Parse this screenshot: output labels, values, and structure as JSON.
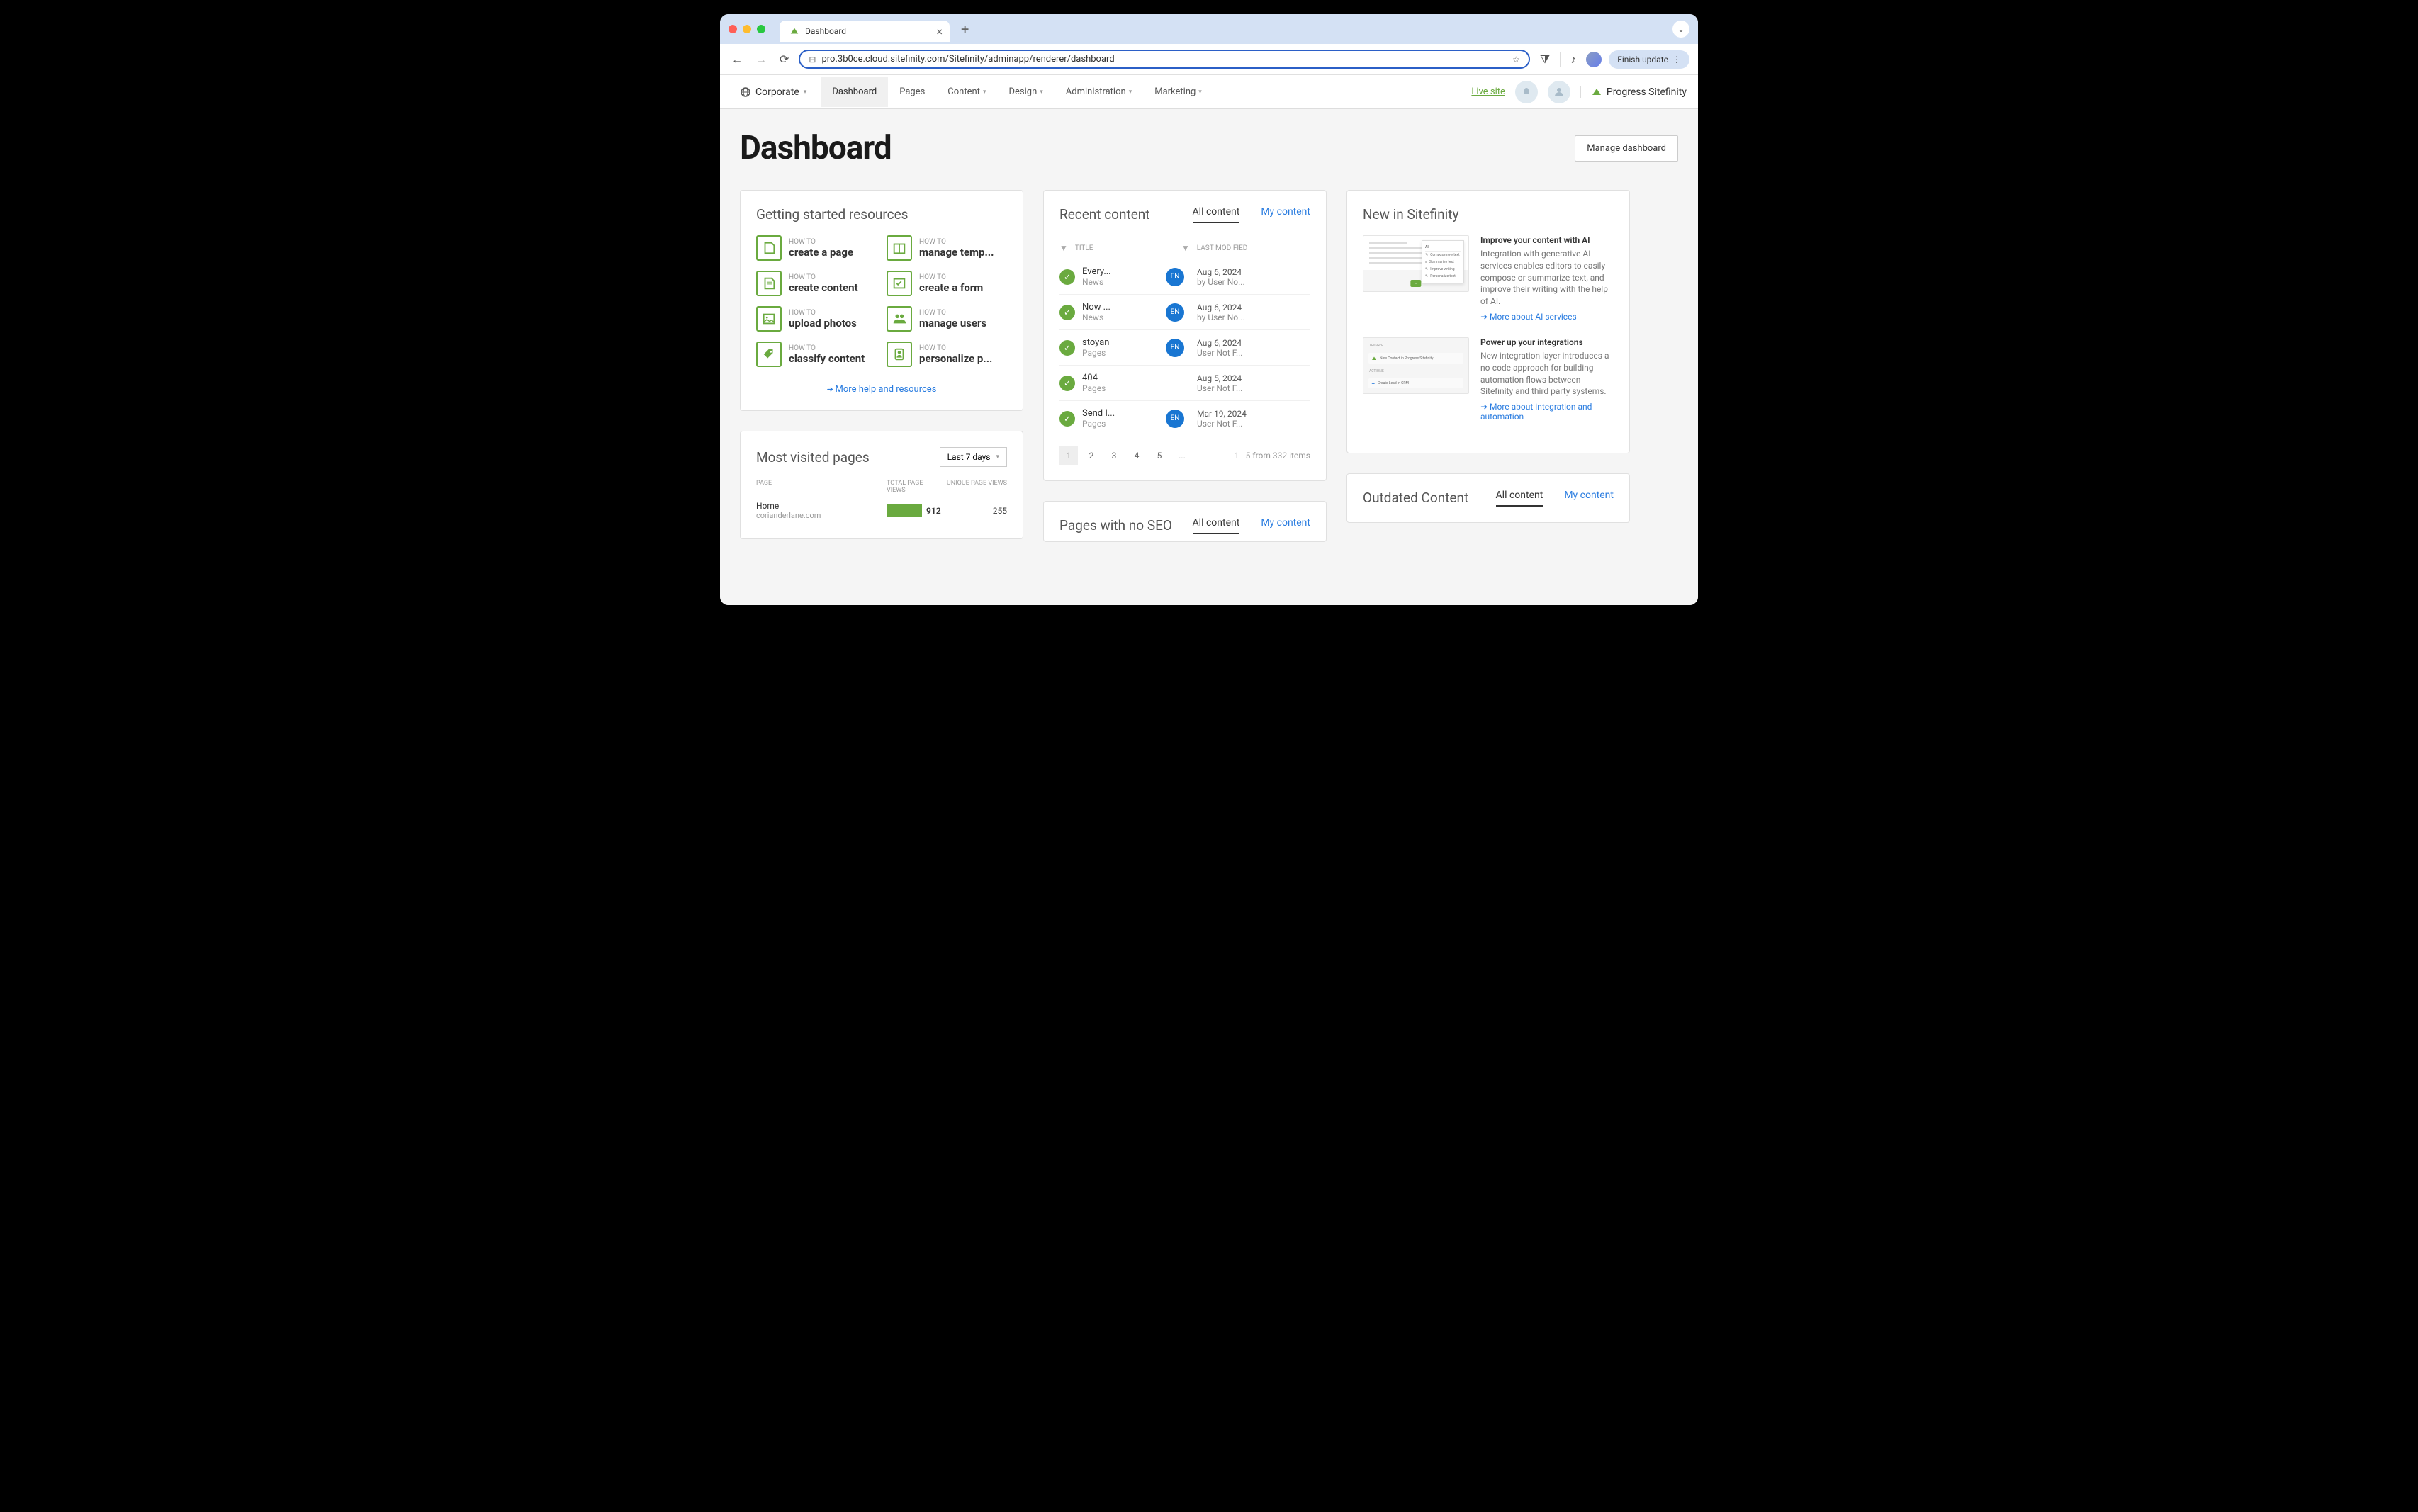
{
  "browser": {
    "tab_title": "Dashboard",
    "url": "pro.3b0ce.cloud.sitefinity.com/Sitefinity/adminapp/renderer/dashboard",
    "finish_update": "Finish update"
  },
  "header": {
    "site": "Corporate",
    "nav": [
      "Dashboard",
      "Pages",
      "Content",
      "Design",
      "Administration",
      "Marketing"
    ],
    "live_site": "Live site",
    "brand": "Progress Sitefinity"
  },
  "page": {
    "title": "Dashboard",
    "manage": "Manage dashboard"
  },
  "getting_started": {
    "title": "Getting started resources",
    "items": [
      {
        "cat": "HOW TO",
        "title": "create a page"
      },
      {
        "cat": "HOW TO",
        "title": "manage temp..."
      },
      {
        "cat": "HOW TO",
        "title": "create content"
      },
      {
        "cat": "HOW TO",
        "title": "create a form"
      },
      {
        "cat": "HOW TO",
        "title": "upload photos"
      },
      {
        "cat": "HOW TO",
        "title": "manage users"
      },
      {
        "cat": "HOW TO",
        "title": "classify content"
      },
      {
        "cat": "HOW TO",
        "title": "personalize p..."
      }
    ],
    "more": "More help and resources"
  },
  "recent": {
    "title": "Recent content",
    "tabs": {
      "all": "All content",
      "my": "My content"
    },
    "cols": {
      "title": "TITLE",
      "modified": "LAST MODIFIED"
    },
    "rows": [
      {
        "title": "Every...",
        "type": "News",
        "lang": "EN",
        "date": "Aug 6, 2024",
        "user": "by User No..."
      },
      {
        "title": "Now ...",
        "type": "News",
        "lang": "EN",
        "date": "Aug 6, 2024",
        "user": "by User No..."
      },
      {
        "title": "stoyan",
        "type": "Pages",
        "lang": "EN",
        "date": "Aug 6, 2024",
        "user": "User Not F..."
      },
      {
        "title": "404",
        "type": "Pages",
        "lang": "",
        "date": "Aug 5, 2024",
        "user": "User Not F..."
      },
      {
        "title": "Send I...",
        "type": "Pages",
        "lang": "EN",
        "date": "Mar 19, 2024",
        "user": "User Not F..."
      }
    ],
    "pages": [
      "1",
      "2",
      "3",
      "4",
      "5",
      "..."
    ],
    "pager_info": "1 - 5 from 332 items"
  },
  "news": {
    "title": "New in Sitefinity",
    "items": [
      {
        "title": "Improve your content with AI",
        "desc": "Integration with generative AI services enables editors to easily compose or summarize text, and improve their writing with the help of AI.",
        "link": "More about AI services"
      },
      {
        "title": "Power up your integrations",
        "desc": "New integration layer introduces a no-code approach for building automation flows between Sitefinity and third party systems.",
        "link": "More about integration and automation"
      }
    ],
    "thumb1": {
      "ai": "AI",
      "compose": "Compose new text",
      "summarize": "Summarize text",
      "improve": "Improve writing",
      "personalize": "Personalize text",
      "btn": "…"
    },
    "thumb2": {
      "trigger": "TRIGGER",
      "contact": "New Contact in Progress Sitefinity",
      "actions": "ACTIONS",
      "lead": "Create Lead in CRM"
    }
  },
  "mvp": {
    "title": "Most visited pages",
    "period": "Last 7 days",
    "cols": {
      "page": "PAGE",
      "total": "TOTAL PAGE VIEWS",
      "unique": "UNIQUE PAGE VIEWS"
    },
    "rows": [
      {
        "name": "Home",
        "domain": "corianderlane.com",
        "total": "912",
        "unique": "255"
      }
    ]
  },
  "seo": {
    "title": "Pages with no SEO",
    "tabs": {
      "all": "All content",
      "my": "My content"
    }
  },
  "outdated": {
    "title": "Outdated Content",
    "tabs": {
      "all": "All content",
      "my": "My content"
    }
  }
}
